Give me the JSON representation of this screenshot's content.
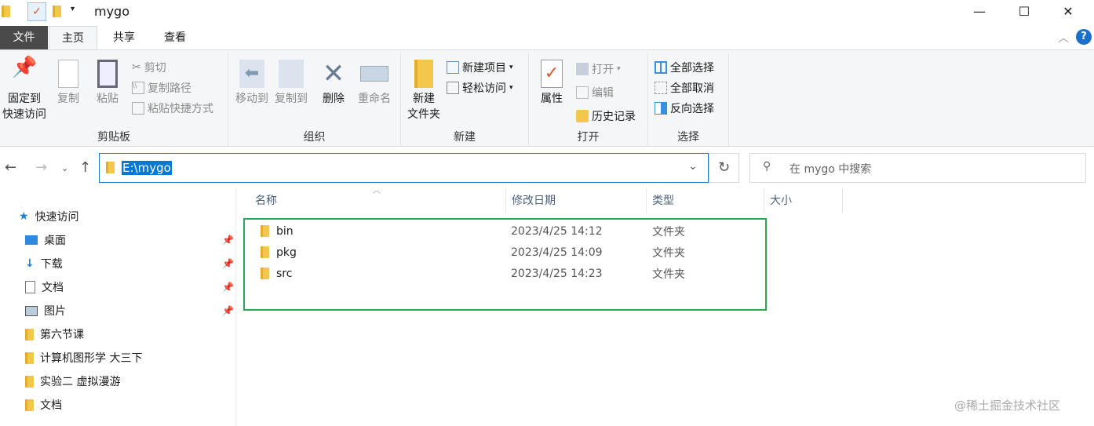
{
  "window": {
    "title": "mygo",
    "minimize": "—",
    "maximize": "☐",
    "close": "✕"
  },
  "tabs": {
    "file": "文件",
    "home": "主页",
    "share": "共享",
    "view": "查看"
  },
  "ribbon": {
    "clipboard": {
      "label": "剪贴板",
      "pin": "固定到",
      "pin2": "快速访问",
      "copy": "复制",
      "paste": "粘贴",
      "cut": "剪切",
      "copy_path": "复制路径",
      "paste_shortcut": "粘贴快捷方式"
    },
    "organize": {
      "label": "组织",
      "move_to": "移动到",
      "copy_to": "复制到",
      "delete": "删除",
      "rename": "重命名"
    },
    "new": {
      "label": "新建",
      "new_folder": "新建",
      "new_folder2": "文件夹",
      "new_item": "新建项目",
      "easy_access": "轻松访问"
    },
    "open": {
      "label": "打开",
      "properties": "属性",
      "open": "打开",
      "edit": "编辑",
      "history": "历史记录"
    },
    "select": {
      "label": "选择",
      "select_all": "全部选择",
      "select_none": "全部取消",
      "invert": "反向选择"
    }
  },
  "address": {
    "path": "E:\\mygo",
    "search_placeholder": "在 mygo 中搜索"
  },
  "sidebar": {
    "quick_access": "快速访问",
    "items": [
      {
        "label": "桌面",
        "pinned": true
      },
      {
        "label": "下载",
        "pinned": true
      },
      {
        "label": "文档",
        "pinned": true
      },
      {
        "label": "图片",
        "pinned": true
      },
      {
        "label": "第六节课"
      },
      {
        "label": "计算机图形学 大三下"
      },
      {
        "label": "实验二 虚拟漫游"
      },
      {
        "label": "文档"
      }
    ]
  },
  "columns": {
    "name": "名称",
    "date": "修改日期",
    "type": "类型",
    "size": "大小"
  },
  "files": [
    {
      "name": "bin",
      "date": "2023/4/25 14:12",
      "type": "文件夹"
    },
    {
      "name": "pkg",
      "date": "2023/4/25 14:09",
      "type": "文件夹"
    },
    {
      "name": "src",
      "date": "2023/4/25 14:23",
      "type": "文件夹"
    }
  ],
  "watermark": "@稀土掘金技术社区"
}
